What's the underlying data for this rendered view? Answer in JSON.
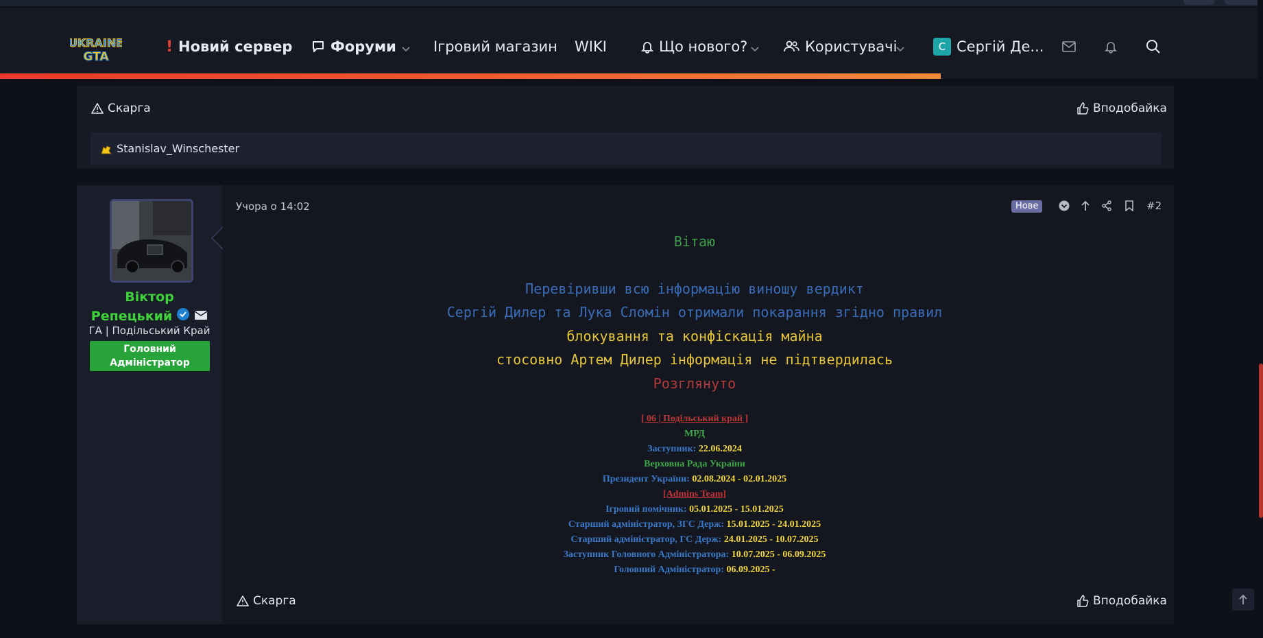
{
  "nav": {
    "logo_line1": "UKRAINE",
    "logo_line2": "GTA",
    "new_server": "Новий сервер",
    "forums": "Форуми",
    "shop": "Ігровий магазин",
    "wiki": "WIKI",
    "whats_new": "Що нового?",
    "users": "Користувачі",
    "account_initial": "С",
    "account_name": "Сергій Де...",
    "progress": 0.745
  },
  "prev_post": {
    "report": "Скарга",
    "like": "Вподобайка",
    "liked_by": "Stanislav_Winschester"
  },
  "post": {
    "user": {
      "name_line1": "Віктор",
      "name_line2": "Репецький",
      "title": "ГА | Подільський Край",
      "role": "Головний Адміністратор"
    },
    "date": "Учора о 14:02",
    "badge": "Нове",
    "number": "#2",
    "lines": [
      "Вітаю",
      "Перевіривши всю інформацію виношу вердикт",
      "Сергій Дилер та Лука Сломін отримали покарання згідно правил",
      "блокування та конфіскація майна",
      "стосовно Артем Дилер інформація не підтвердилась",
      "Розглянуто"
    ],
    "signature": {
      "server": "[ 06 | Подільський край ]",
      "mrd": "МРД",
      "deputy_label": "Заступник:",
      "deputy_value": "22.06.2024",
      "rada": "Верховна Рада України",
      "president_label": "Президент України:",
      "president_value": "02.08.2024 - 02.01.2025",
      "admins_team": "[Admins Team]",
      "rows": [
        {
          "label": "Ігровий помічник:",
          "value": "05.01.2025 - 15.01.2025"
        },
        {
          "label": "Старший адміністратор, ЗГС Держ:",
          "value": "15.01.2025 - 24.01.2025"
        },
        {
          "label": "Старший адміністратор, ГС Держ:",
          "value": "24.01.2025 - 10.07.2025"
        },
        {
          "label": "Заступник Головного Адміністратора:",
          "value": "10.07.2025 - 06.09.2025"
        },
        {
          "label": "Головний Адміністратор:",
          "value": "06.09.2025 -"
        }
      ]
    },
    "report": "Скарга",
    "like": "Вподобайка"
  },
  "colors": {
    "accent_red": "#e83a2a",
    "accent_orange": "#f08a3a",
    "user_green": "#3fd13a",
    "role_green": "#27a33a"
  }
}
